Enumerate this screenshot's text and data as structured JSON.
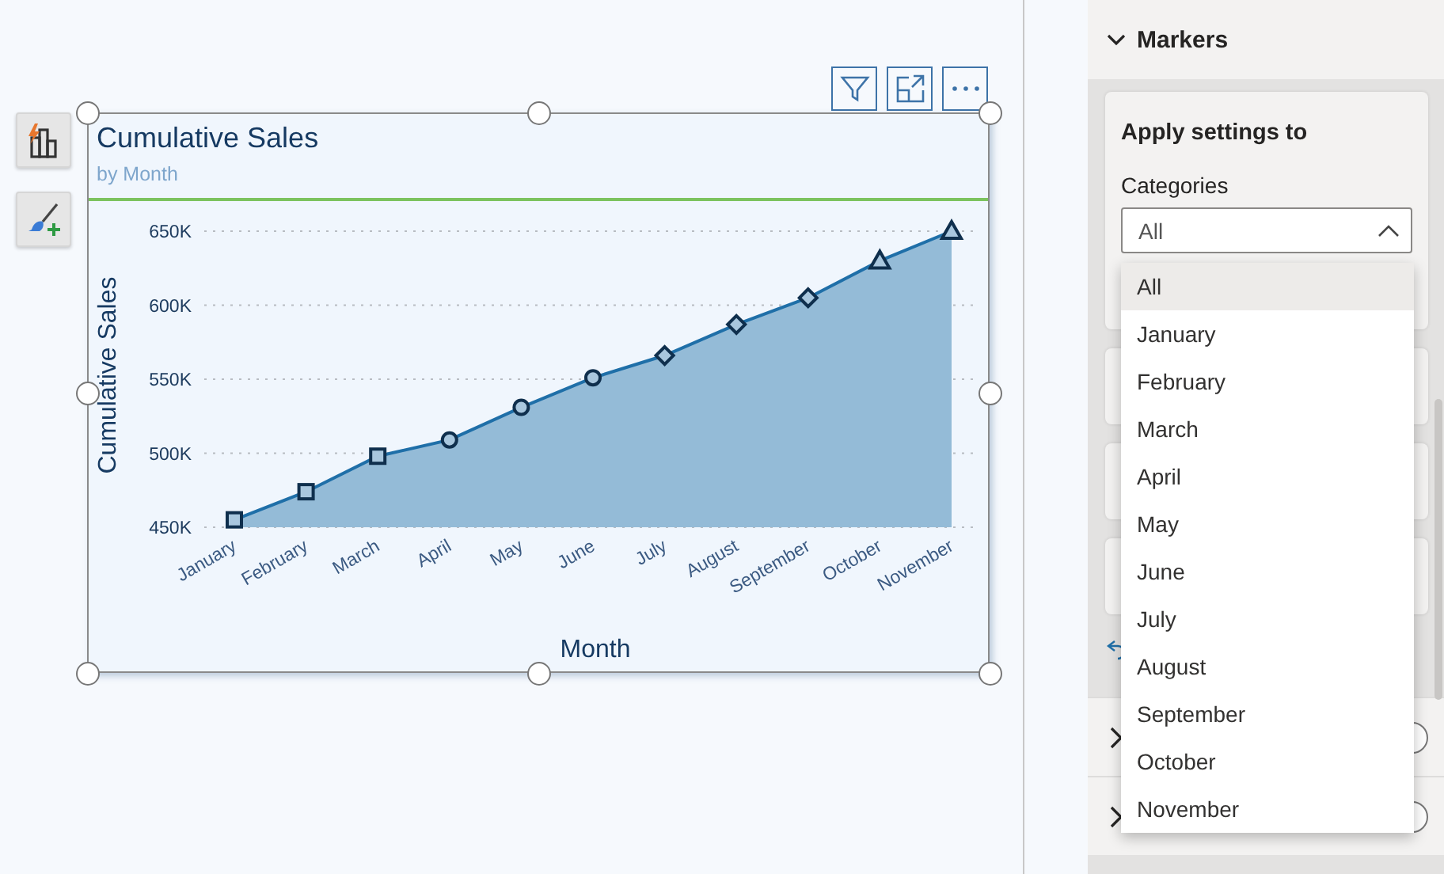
{
  "canvas": {
    "visual": {
      "title": "Cumulative Sales",
      "subtitle": "by Month",
      "point_markers": [
        {
          "kind": "square"
        },
        {
          "kind": "square"
        },
        {
          "kind": "square"
        },
        {
          "kind": "circle"
        },
        {
          "kind": "circle"
        },
        {
          "kind": "circle"
        },
        {
          "kind": "diamond"
        },
        {
          "kind": "diamond"
        },
        {
          "kind": "diamond"
        },
        {
          "kind": "triangle"
        },
        {
          "kind": "triangle"
        }
      ],
      "chart_data": {
        "type": "area",
        "xlabel": "Month",
        "ylabel": "Cumulative Sales",
        "grid": true,
        "categories": [
          "January",
          "February",
          "March",
          "April",
          "May",
          "June",
          "July",
          "August",
          "September",
          "October",
          "November"
        ],
        "series": [
          {
            "color": "#1f6fa8",
            "values": [
              455000,
              474000,
              498000,
              509000,
              531000,
              551000,
              566000,
              587000,
              605000,
              630000,
              650000
            ]
          }
        ],
        "ylim": [
          450000,
          650000
        ],
        "yticks": [
          {
            "value": 450000,
            "label": "450K"
          },
          {
            "value": 500000,
            "label": "500K"
          },
          {
            "value": 550000,
            "label": "550K"
          },
          {
            "value": 600000,
            "label": "600K"
          },
          {
            "value": 650000,
            "label": "650K"
          }
        ]
      }
    }
  },
  "format_pane": {
    "section": {
      "title": "Markers",
      "expanded": true
    },
    "apply_settings": {
      "heading": "Apply settings to",
      "field_label": "Categories",
      "dropdown": {
        "value": "All",
        "open": true,
        "options": [
          {
            "label": "All",
            "selected": true
          },
          {
            "label": "January",
            "selected": false
          },
          {
            "label": "February",
            "selected": false
          },
          {
            "label": "March",
            "selected": false
          },
          {
            "label": "April",
            "selected": false
          },
          {
            "label": "May",
            "selected": false
          },
          {
            "label": "June",
            "selected": false
          },
          {
            "label": "July",
            "selected": false
          },
          {
            "label": "August",
            "selected": false
          },
          {
            "label": "September",
            "selected": false
          },
          {
            "label": "October",
            "selected": false
          },
          {
            "label": "November",
            "selected": false
          }
        ]
      }
    },
    "collapsed_rows": [
      {
        "on": false
      },
      {
        "on": false
      }
    ]
  }
}
